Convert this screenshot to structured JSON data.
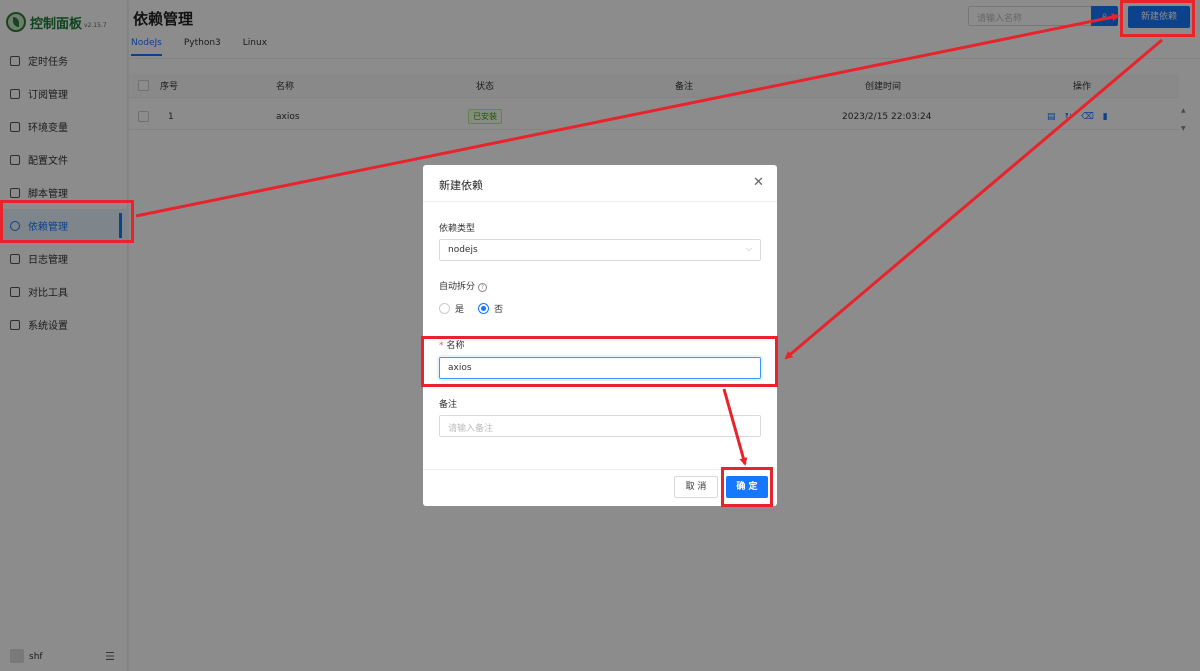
{
  "app": {
    "title": "控制面板",
    "version": "v2.15.7"
  },
  "sidebar": {
    "items": [
      {
        "label": "定时任务",
        "icon": "calendar-icon"
      },
      {
        "label": "订阅管理",
        "icon": "subscription-icon"
      },
      {
        "label": "环境变量",
        "icon": "monitor-icon"
      },
      {
        "label": "配置文件",
        "icon": "config-icon"
      },
      {
        "label": "脚本管理",
        "icon": "script-icon"
      },
      {
        "label": "依赖管理",
        "icon": "dependency-icon",
        "active": true
      },
      {
        "label": "日志管理",
        "icon": "log-icon"
      },
      {
        "label": "对比工具",
        "icon": "diff-icon"
      },
      {
        "label": "系统设置",
        "icon": "gear-icon"
      }
    ],
    "user": "shf"
  },
  "header": {
    "title": "依赖管理",
    "search_placeholder": "请输入名称",
    "new_button": "新建依赖"
  },
  "tabs": [
    "NodeJs",
    "Python3",
    "Linux"
  ],
  "table": {
    "columns": [
      "序号",
      "名称",
      "状态",
      "备注",
      "创建时间",
      "操作"
    ],
    "rows": [
      {
        "index": "1",
        "name": "axios",
        "status": "已安装",
        "remark": "",
        "created": "2023/2/15 22:03:24"
      }
    ]
  },
  "modal": {
    "title": "新建依赖",
    "type_label": "依赖类型",
    "type_value": "nodejs",
    "split_label": "自动拆分",
    "split_options": [
      "是",
      "否"
    ],
    "split_selected": "否",
    "name_label": "名称",
    "name_value": "axios",
    "remark_label": "备注",
    "remark_placeholder": "请输入备注",
    "cancel_label": "取 消",
    "ok_label": "确 定"
  },
  "colors": {
    "primary": "#1677ff",
    "annotation": "#e8232b",
    "success": "#389e0d"
  }
}
